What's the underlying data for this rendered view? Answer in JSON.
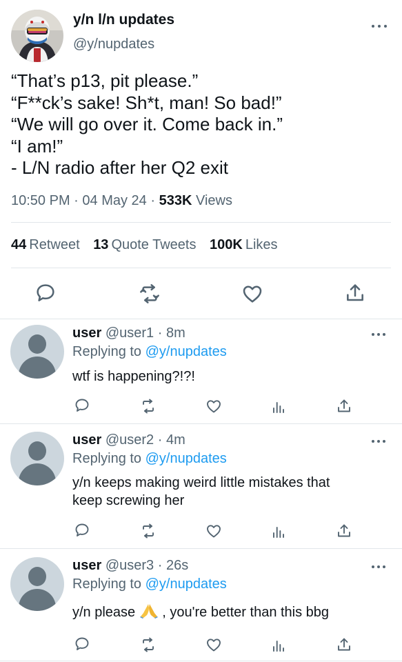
{
  "main_tweet": {
    "display_name": "y/n l/n updates",
    "handle": "@y/nupdates",
    "text_lines": [
      "“That’s p13, pit please.”",
      "“F**ck’s sake! Sh*t, man! So bad!”",
      "“We will go over it. Come back in.”",
      "“I am!”",
      "- L/N radio after her Q2 exit"
    ],
    "time": "10:50 PM",
    "date": "04 May 24",
    "views_count": "533K",
    "views_label": "Views",
    "retweets_count": "44",
    "retweets_label": "Retweet",
    "quotes_count": "13",
    "quotes_label": "Quote Tweets",
    "likes_count": "100K",
    "likes_label": "Likes"
  },
  "replies": [
    {
      "name": "user",
      "handle": "@user1",
      "time": "8m",
      "replying_prefix": "Replying to",
      "replying_to": "@y/nupdates",
      "text_lines": [
        "wtf is happening?!?!"
      ]
    },
    {
      "name": "user",
      "handle": "@user2",
      "time": "4m",
      "replying_prefix": "Replying to",
      "replying_to": "@y/nupdates",
      "text_lines": [
        "y/n keeps making weird little mistakes that",
        "keep screwing her"
      ]
    },
    {
      "name": "user",
      "handle": "@user3",
      "time": "26s",
      "replying_prefix": "Replying to",
      "replying_to": "@y/nupdates",
      "text_before_emoji": "y/n please",
      "text_after_emoji": ", you're better than this bbg"
    }
  ],
  "separator": "·",
  "colors": {
    "link": "#1d9bf0",
    "secondary_text": "#536471",
    "primary_text": "#0f1419"
  }
}
